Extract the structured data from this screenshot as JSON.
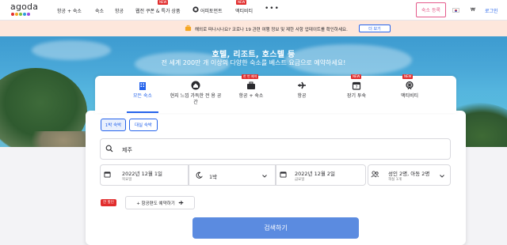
{
  "brand": {
    "logo_text": "agoda",
    "logo_colors": [
      "#e12d2d",
      "#f5a623",
      "#7ac142",
      "#2d9cdb",
      "#9b51e0"
    ]
  },
  "nav": {
    "items": [
      {
        "label": "항공 + 숙소"
      },
      {
        "label": "숙소"
      },
      {
        "label": "항공"
      },
      {
        "label": "웹전 쿠폰 & 특가 상품",
        "badge": "NEW"
      },
      {
        "label": "어피토먼트"
      },
      {
        "label": "액티비티",
        "badge": "NEW"
      }
    ],
    "more": "•••",
    "signup": "숙소 등록",
    "currency": "₩",
    "login": "로그인"
  },
  "notice": {
    "text": "해외로 떠나시나요? 코로나 19 관련 여행 정보 및 제한 사항 업데이트를 확인하세요.",
    "button": "더 보기"
  },
  "hero": {
    "title": "호텔, 리조트, 호스텔 등",
    "subtitle": "전 세계 200만 개 이상의 다양한 숙소를 베스트 요금으로 예약하세요!"
  },
  "search": {
    "tabs": [
      {
        "label": "모든 숙소",
        "icon": "building-icon",
        "active": true
      },
      {
        "label": "현지 느낌 가득한 전\n용 공간",
        "icon": "home-icon"
      },
      {
        "label": "항공 + 숙소",
        "icon": "flight-hotel-icon",
        "badge": "한 번 예약"
      },
      {
        "label": "항공",
        "icon": "plane-icon"
      },
      {
        "label": "장기 투숙",
        "icon": "calendar-icon",
        "badge": "NEW"
      },
      {
        "label": "액티비티",
        "icon": "ferris-wheel-icon",
        "badge": "NEW"
      }
    ],
    "toggles": {
      "day_use": "1박 숙박",
      "multi_stay": "대실 숙박"
    },
    "destination": "제주",
    "checkin": {
      "date": "2022년 12월 1일",
      "weekday": "목요일"
    },
    "nights": "1박",
    "checkout": {
      "date": "2022년 12월 2일",
      "weekday": "금요일"
    },
    "guests": {
      "main": "성인 2명, 아동 2명",
      "sub": "객실 1개"
    },
    "bundle_tag": "한 할인",
    "bundle_button": "+ 항공편도 예약하기",
    "search_button": "검색하기"
  }
}
